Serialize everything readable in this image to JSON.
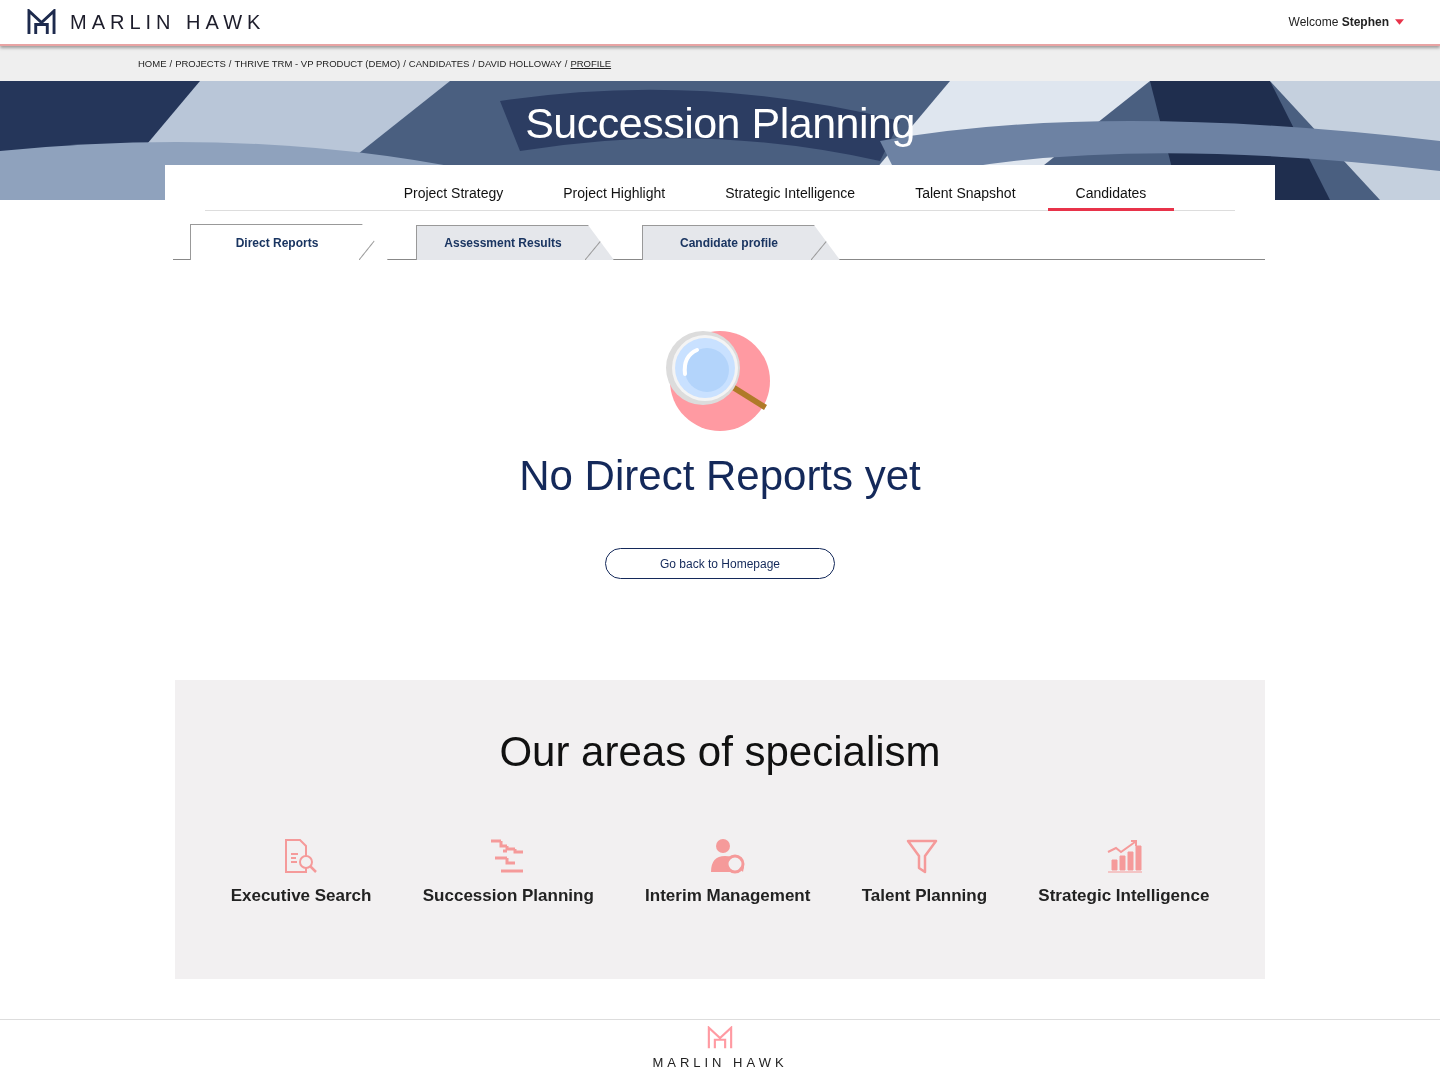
{
  "header": {
    "brand": "MARLIN HAWK",
    "welcome": "Welcome **Stephen**"
  },
  "breadcrumb": [
    {
      "label": "HOME",
      "current": false
    },
    {
      "label": "PROJECTS",
      "current": false
    },
    {
      "label": "THRIVE TRM - VP PRODUCT (DEMO)",
      "current": false
    },
    {
      "label": "CANDIDATES",
      "current": false
    },
    {
      "label": "DAVID HOLLOWAY",
      "current": false
    },
    {
      "label": "PROFILE",
      "current": true
    }
  ],
  "breadcrumb_separator": "/",
  "hero": {
    "title": "Succession Planning"
  },
  "tabs": [
    {
      "label": "Project Strategy",
      "selected": false
    },
    {
      "label": "Project Highlight",
      "selected": false
    },
    {
      "label": "Strategic Intelligence",
      "selected": false
    },
    {
      "label": "Talent Snapshot",
      "selected": false
    },
    {
      "label": "Candidates",
      "selected": true
    }
  ],
  "sub_tabs": [
    {
      "label": "Direct Reports",
      "selected": true
    },
    {
      "label": "Assessment Results",
      "selected": false
    },
    {
      "label": "Candidate profile",
      "selected": false
    }
  ],
  "empty_state": {
    "message": "No Direct Reports yet",
    "button": "Go back to Homepage"
  },
  "specialism": {
    "title": "Our areas of specialism",
    "items": [
      {
        "kind": "search",
        "label": "Executive Search"
      },
      {
        "kind": "steps",
        "label": "Succession Planning"
      },
      {
        "kind": "person",
        "label": "Interim Management"
      },
      {
        "kind": "funnel",
        "label": "Talent Planning"
      },
      {
        "kind": "chart",
        "label": "Strategic Intelligence"
      }
    ]
  },
  "footer": {
    "brand": "MARLIN HAWK"
  }
}
